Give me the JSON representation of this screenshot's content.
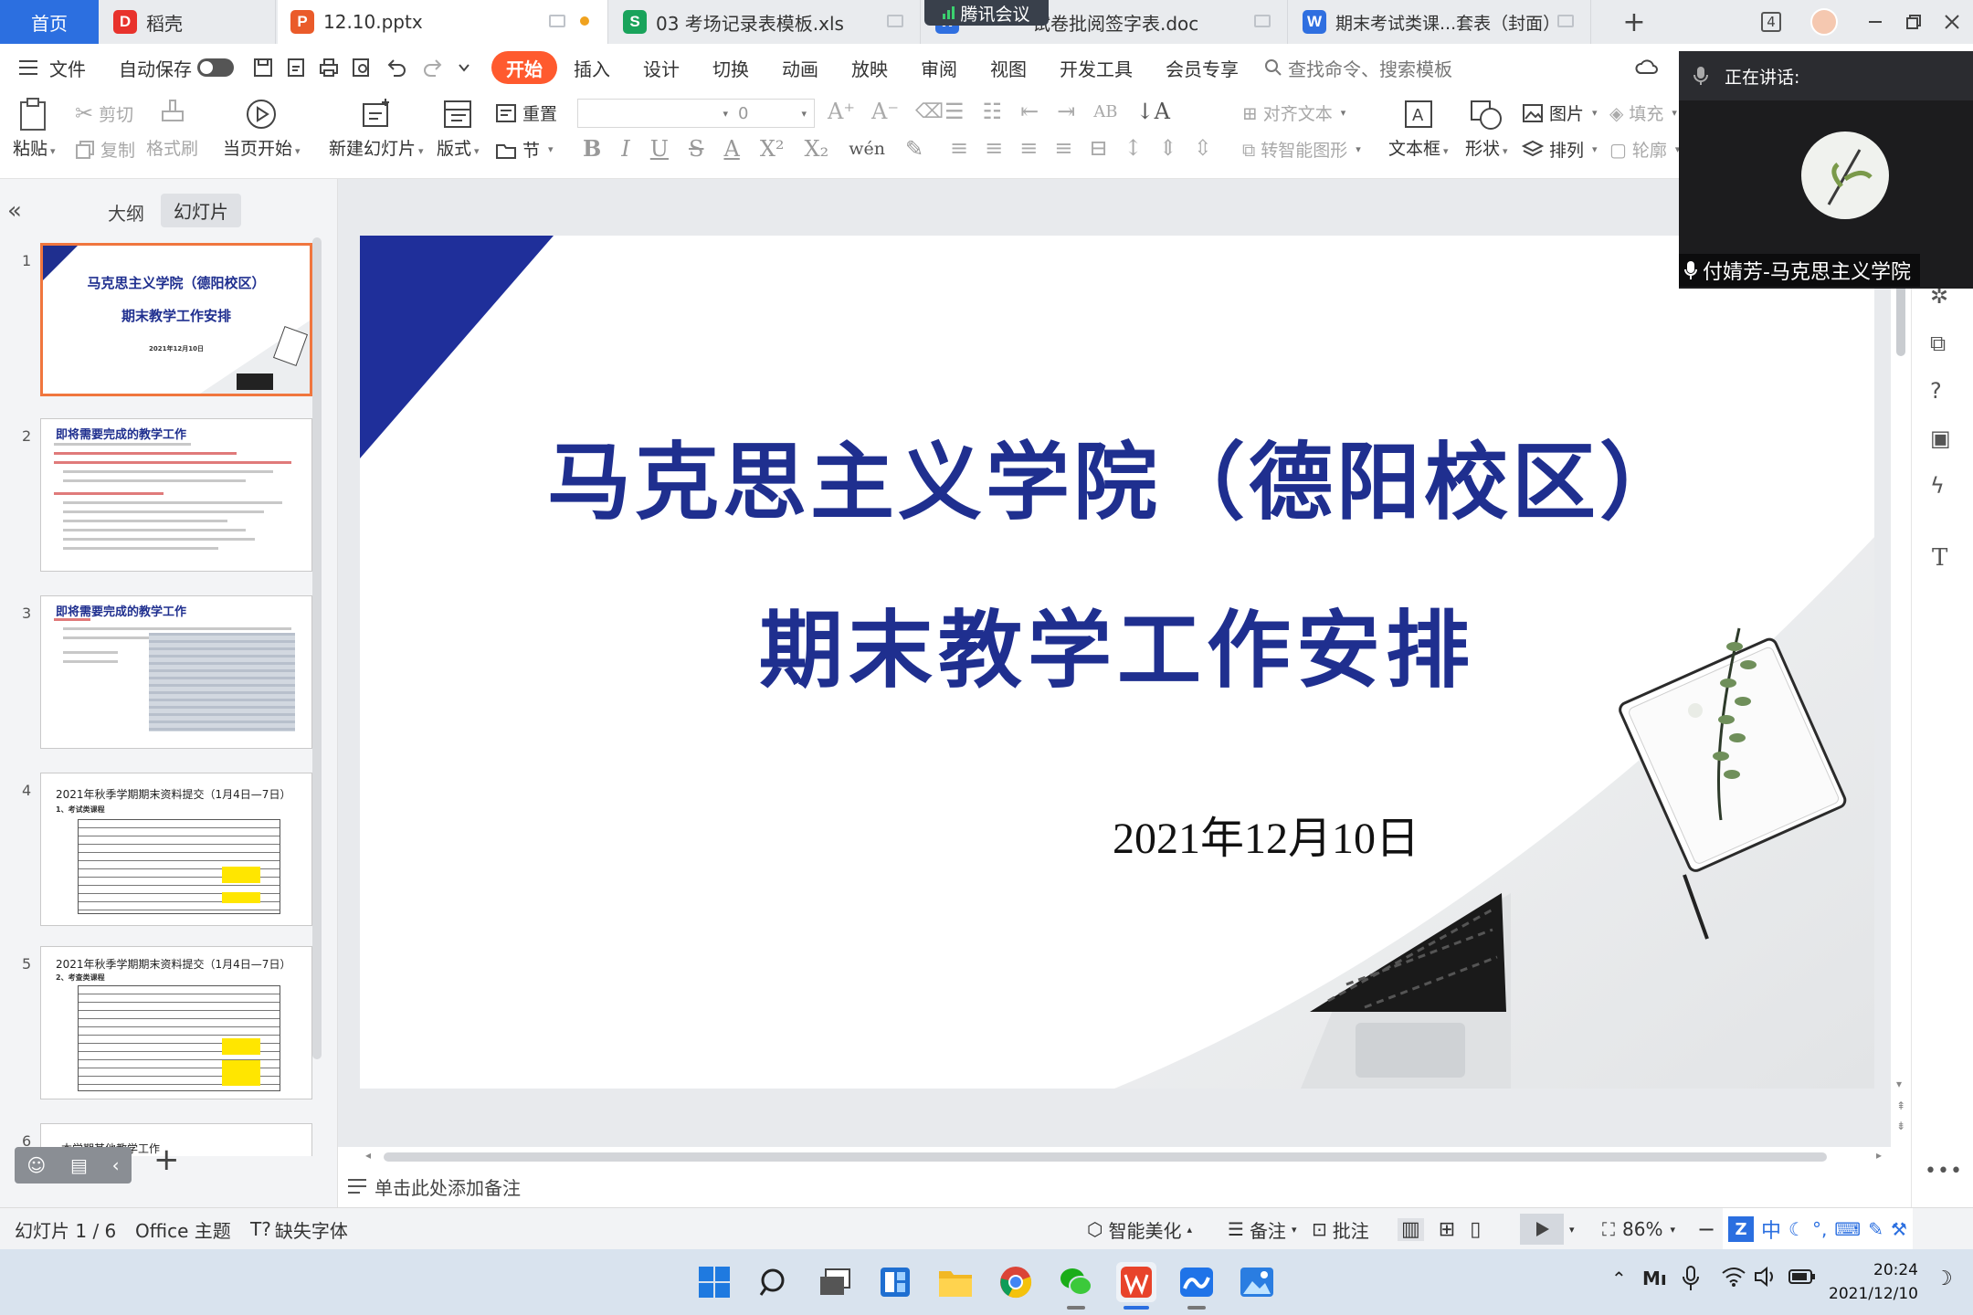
{
  "tabs": {
    "home": "首页",
    "daoke": "稻壳",
    "pptx": "12.10.pptx",
    "xls": "03 考场记录表模板.xls",
    "doc": "试卷批阅签字表.doc",
    "exam": "期末考试类课...套表（封面）",
    "tencent_meeting": "腾讯会议",
    "new_tab": "+"
  },
  "titlebar_right": {
    "window_count": "4"
  },
  "ribbon_tabs": [
    "文件",
    "自动保存",
    "开始",
    "插入",
    "设计",
    "切换",
    "动画",
    "放映",
    "审阅",
    "视图",
    "开发工具",
    "会员专享"
  ],
  "search_placeholder": "查找命令、搜索模板",
  "toolbar": {
    "paste": "粘贴",
    "cut": "剪切",
    "copy": "复制",
    "format_painter": "格式刷",
    "from_current": "当页开始",
    "new_slide": "新建幻灯片",
    "layout": "版式",
    "reset": "重置",
    "section": "节",
    "font_size": "0",
    "align_text": "对齐文本",
    "convert_smartart": "转智能图形",
    "textbox": "文本框",
    "shape": "形状",
    "picture": "图片",
    "arrange": "排列",
    "fill": "填充",
    "outline": "轮廓"
  },
  "panel_tabs": {
    "outline": "大纲",
    "slides": "幻灯片"
  },
  "thumbnails": [
    {
      "num": "1",
      "title": "马克思主义学院（德阳校区）",
      "subtitle": "期末教学工作安排",
      "date": "2021年12月10日"
    },
    {
      "num": "2",
      "title": "即将需要完成的教学工作"
    },
    {
      "num": "3",
      "title": "即将需要完成的教学工作"
    },
    {
      "num": "4",
      "title": "2021年秋季学期期末资料提交（1月4日—7日）",
      "subtitle": "1、考试类课程"
    },
    {
      "num": "5",
      "title": "2021年秋季学期期末资料提交（1月4日—7日）",
      "subtitle": "2、考查类课程"
    },
    {
      "num": "6",
      "title": "本学期其他教学工作"
    }
  ],
  "slide": {
    "title": "马克思主义学院（德阳校区）",
    "subtitle": "期末教学工作安排",
    "date": "2021年12月10日"
  },
  "notes_placeholder": "单击此处添加备注",
  "tencent_overlay": {
    "speaking_label": "正在讲话:",
    "speaker": "付婧芳-马克思主义学院"
  },
  "status": {
    "slide_counter": "幻灯片 1 / 6",
    "theme": "Office 主题",
    "missing_fonts": "缺失字体",
    "smart_beautify": "智能美化",
    "notes": "备注",
    "comments": "批注",
    "zoom": "86%",
    "ime_chinese": "中"
  },
  "clock": {
    "time": "20:24",
    "date": "2021/12/10"
  },
  "colors": {
    "accent_orange": "#ff5a2e",
    "slide_blue": "#1f2f8f",
    "home_tab_blue": "#2c6fe0",
    "selection_border": "#f0763e"
  }
}
